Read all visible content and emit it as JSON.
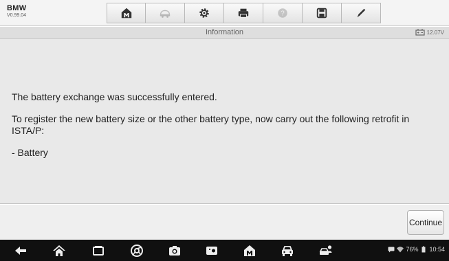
{
  "app": {
    "brand": "BMW",
    "version": "V0.99.04"
  },
  "toolbar": {
    "buttons": [
      {
        "icon": "home-icon",
        "enabled": true
      },
      {
        "icon": "vehicle-swap-icon",
        "enabled": false
      },
      {
        "icon": "settings-icon",
        "enabled": true
      },
      {
        "icon": "print-icon",
        "enabled": true
      },
      {
        "icon": "help-icon",
        "enabled": false
      },
      {
        "icon": "save-icon",
        "enabled": true
      },
      {
        "icon": "edit-icon",
        "enabled": true
      }
    ]
  },
  "infobar": {
    "title": "Information",
    "voltage": "12.07V"
  },
  "message": {
    "line1": "The battery exchange was successfully entered.",
    "line2": "To register the new battery size or the other battery type, now carry out the following retrofit in ISTA/P:",
    "line3": "- Battery"
  },
  "footer": {
    "continue_label": "Continue"
  },
  "navbar": {
    "icons": [
      "back-icon",
      "home-icon",
      "recent-apps-icon",
      "browser-icon",
      "camera-icon",
      "screen-capture-icon",
      "autel-home-icon",
      "vehicle-icon",
      "vci-icon"
    ],
    "status": {
      "battery": "76%",
      "time": "10:54"
    }
  },
  "colors": {
    "navbar": "#101010",
    "content_bg": "#e9e9e9",
    "toolbar_bg": "#f4f4f4"
  }
}
